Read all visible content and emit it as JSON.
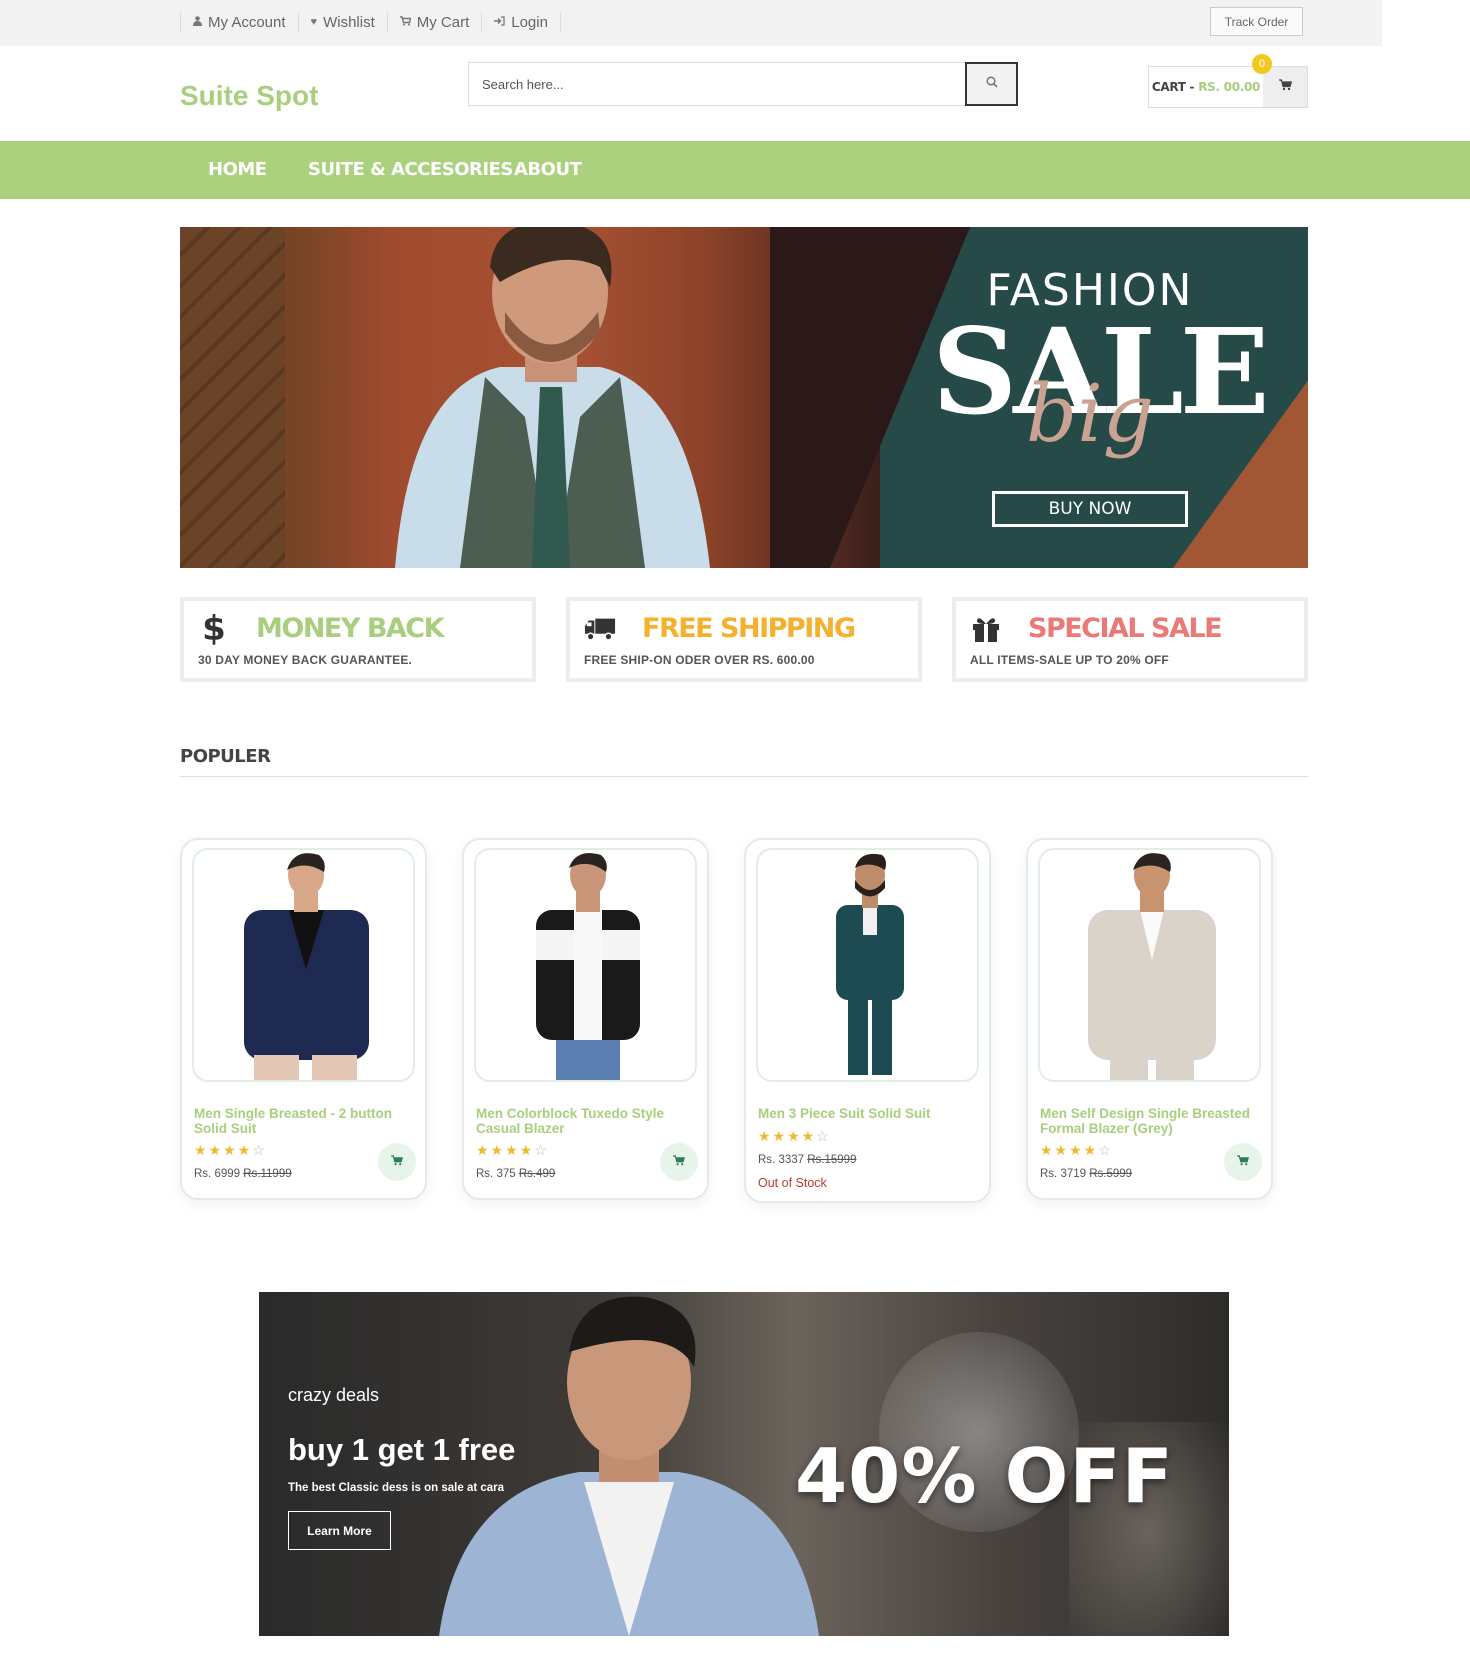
{
  "topbar": {
    "links": [
      {
        "label": "My Account",
        "icon": "user-icon"
      },
      {
        "label": "Wishlist",
        "icon": "heart-icon"
      },
      {
        "label": "My Cart",
        "icon": "cart-icon"
      },
      {
        "label": "Login",
        "icon": "login-icon"
      }
    ],
    "track_order": "Track Order"
  },
  "header": {
    "logo": "Suite Spot",
    "search_placeholder": "Search here...",
    "cart_label": "CART -",
    "cart_amount": "RS. 00.00",
    "cart_count": "0"
  },
  "nav": {
    "items": [
      "HOME",
      "SUITE & ACCESORIES",
      "ABOUT"
    ]
  },
  "hero": {
    "line1": "FASHION",
    "line2": "SALE",
    "line3": "big",
    "cta": "BUY NOW"
  },
  "features": [
    {
      "title": "MONEY BACK",
      "desc": "30 DAY MONEY BACK GUARANTEE.",
      "icon": "dollar-icon",
      "color": "#a9cf7e"
    },
    {
      "title": "FREE SHIPPING",
      "desc": "FREE SHIP-ON ODER OVER RS. 600.00",
      "icon": "truck-icon",
      "color": "#f4b12e"
    },
    {
      "title": "SPECIAL SALE",
      "desc": "ALL ITEMS-SALE UP TO 20% OFF",
      "icon": "gift-icon",
      "color": "#ea7a76"
    }
  ],
  "section": {
    "title": "POPULER"
  },
  "products": [
    {
      "name": "Men Single Breasted - 2 button Solid Suit",
      "rating": 4,
      "price": "Rs. 6999",
      "old_price": "Rs.11999",
      "status": ""
    },
    {
      "name": "Men Colorblock Tuxedo Style Casual Blazer",
      "rating": 4,
      "price": "Rs. 375",
      "old_price": "Rs.499",
      "status": ""
    },
    {
      "name": "Men 3 Piece Suit Solid Suit",
      "rating": 4,
      "price": "Rs. 3337",
      "old_price": "Rs.15999",
      "status": "Out of Stock"
    },
    {
      "name": "Men Self Design Single Breasted Formal Blazer (Grey)",
      "rating": 4,
      "price": "Rs. 3719",
      "old_price": "Rs.5999",
      "status": ""
    }
  ],
  "deal": {
    "kicker": "crazy deals",
    "headline": "buy 1 get 1 free",
    "sub": "The best Classic dess is on sale at cara",
    "cta": "Learn More",
    "offer": "40% OFF"
  },
  "colors": {
    "brand_green": "#abd17f",
    "accent_yellow": "#f2c81e",
    "hero_teal": "#254a47",
    "out_of_stock": "#c0392b"
  }
}
